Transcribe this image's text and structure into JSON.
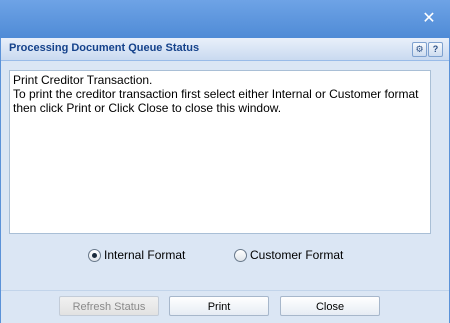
{
  "window": {
    "close_glyph": "✕"
  },
  "panel": {
    "title": "Processing Document Queue Status",
    "tools": {
      "gear_glyph": "⚙",
      "help_glyph": "?"
    }
  },
  "message": {
    "line1": "Print Creditor Transaction.",
    "line2": "To print the creditor transaction first select either Internal or Customer format",
    "line3": "then click Print or Click Close to close this window."
  },
  "format_options": [
    {
      "label": "Internal Format",
      "selected": true
    },
    {
      "label": "Customer Format",
      "selected": false
    }
  ],
  "buttons": {
    "refresh": {
      "label": "Refresh Status",
      "enabled": false
    },
    "print": {
      "label": "Print",
      "enabled": true
    },
    "close": {
      "label": "Close",
      "enabled": true
    }
  },
  "colors": {
    "title_text": "#15428b",
    "background": "#5b92d8",
    "panel_bg": "#dbe6f4"
  }
}
